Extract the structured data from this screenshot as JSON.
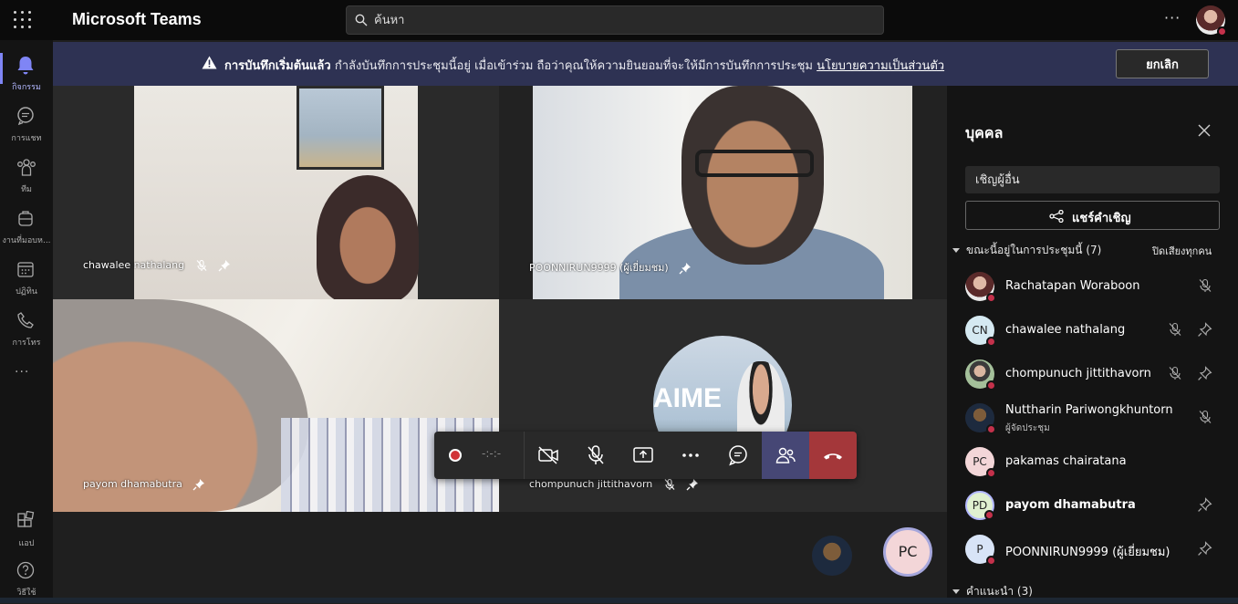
{
  "app": {
    "title": "Microsoft Teams"
  },
  "search": {
    "placeholder": "ค้นหา"
  },
  "rail": [
    {
      "label": "กิจกรรม",
      "icon": "bell-icon",
      "active": true
    },
    {
      "label": "การแชท",
      "icon": "chat-icon"
    },
    {
      "label": "ทีม",
      "icon": "teams-icon"
    },
    {
      "label": "งานที่มอบห...",
      "icon": "assignments-icon"
    },
    {
      "label": "ปฏิทิน",
      "icon": "calendar-icon"
    },
    {
      "label": "การโทร",
      "icon": "phone-icon"
    },
    {
      "label": "แอป",
      "icon": "apps-icon"
    },
    {
      "label": "วิธีใช้",
      "icon": "help-icon"
    }
  ],
  "banner": {
    "bold": "การบันทึกเริ่มต้นแล้ว",
    "text": " กำลังบันทึกการประชุมนี้อยู่ เมื่อเข้าร่วม ถือว่าคุณให้ความยินยอมที่จะให้มีการบันทึกการประชุม ",
    "link": "นโยบายความเป็นส่วนตัว",
    "cancel": "ยกเลิก"
  },
  "tiles": [
    {
      "name": "chawalee nathalang",
      "muted": true,
      "pinned": true
    },
    {
      "name": "POONNIRUN9999 (ผู้เยี่ยมชม)",
      "muted": false,
      "pinned": true
    },
    {
      "name": "payom dhamabutra",
      "muted": false,
      "pinned": true
    },
    {
      "name": "chompunuch jittithavorn",
      "muted": true,
      "pinned": true,
      "sign": "AIME"
    }
  ],
  "controls": {
    "timer": "-:-:-"
  },
  "stage": {
    "self_initials": "PC"
  },
  "panel": {
    "title": "บุคคล",
    "invite_placeholder": "เชิญผู้อื่น",
    "share_label": "แชร์คำเชิญ",
    "in_meeting": "ขณะนี้อยู่ในการประชุมนี้ (7)",
    "mute_all": "ปิดเสียงทุกคน",
    "suggested": "คำแนะนำ (3)",
    "people": [
      {
        "name": "Rachatapan Woraboon",
        "avatar": "photo1",
        "initials": "",
        "role": "",
        "mic_off": true,
        "pin": false,
        "bold": false
      },
      {
        "name": "chawalee nathalang",
        "avatar": "cn",
        "initials": "CN",
        "role": "",
        "mic_off": true,
        "pin": true,
        "bold": false
      },
      {
        "name": "chompunuch jittithavorn",
        "avatar": "photo2",
        "initials": "",
        "role": "",
        "mic_off": true,
        "pin": true,
        "bold": false
      },
      {
        "name": "Nuttharin Pariwongkhuntorn",
        "avatar": "photo3",
        "initials": "",
        "role": "ผู้จัดประชุม",
        "mic_off": true,
        "pin": false,
        "bold": false
      },
      {
        "name": "pakamas chairatana",
        "avatar": "pc",
        "initials": "PC",
        "role": "",
        "mic_off": false,
        "pin": false,
        "bold": false
      },
      {
        "name": "payom dhamabutra",
        "avatar": "pd",
        "initials": "PD",
        "role": "",
        "mic_off": false,
        "pin": true,
        "bold": true
      },
      {
        "name": "POONNIRUN9999 (ผู้เยี่ยมชม)",
        "avatar": "pp",
        "initials": "P",
        "role": "",
        "mic_off": false,
        "pin": true,
        "bold": false
      }
    ]
  }
}
